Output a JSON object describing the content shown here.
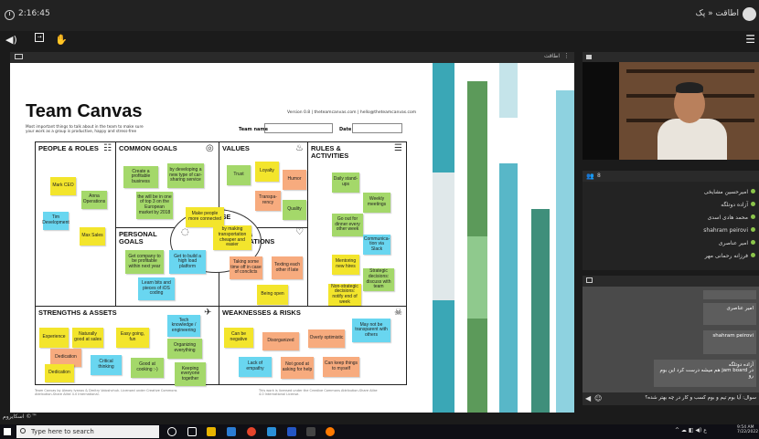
{
  "top_bar": {
    "clock": "2:16:45",
    "room_title": "اطاقت « پک"
  },
  "share_panel": {
    "header_label": "اطاقت",
    "dots": "⋮"
  },
  "canvas": {
    "title": "Team Canvas",
    "subtitle": "Most important things to talk about in the team to make sure your work as a group is productive, happy and stress-free",
    "version": "Version 0.8 | theteamcanvas.com | hello@theteamcanvas.com",
    "team_name_label": "Team name",
    "date_label": "Date",
    "sections": {
      "people": "PEOPLE & ROLES",
      "goals": "COMMON GOALS",
      "values": "VALUES",
      "rules": "RULES & ACTIVITIES",
      "personal": "PERSONAL GOALS",
      "needs": "NEEDS & EXPECTATIONS",
      "strengths": "STRENGTHS & ASSETS",
      "weaknesses": "WEAKNESSES & RISKS",
      "purpose": "PURPOSE"
    },
    "notes": {
      "mark": "Mark\nCEO",
      "anna": "Anna\nOperations",
      "tim": "Tim\nDevelopment",
      "max": "Max\nSales",
      "profitable": "Create a profitable business",
      "carsharing": "by developing a new type of car-sharing service",
      "top3": "the will be in one of top 3 on the European market by 2018",
      "connected": "Make people more connected",
      "transport": "by making transportation cheaper and easier",
      "trust": "Trust",
      "loyalty": "Loyalty",
      "humor": "Humor",
      "transparency": "Transpa-rency",
      "quality": "Quality",
      "standup": "Daily stand-ups",
      "weekly": "Weekly meetings",
      "dinner": "Go out for dinner every other week",
      "slack": "Communica-tion via Slack",
      "mentoring": "Mentoring new hires",
      "strategic": "Strategic decisions: discuss with team",
      "nonstrategic": "Non-strategic decisions: notify end of week",
      "company": "Get company to be profitable within next year",
      "platform": "Get to build a high load platform",
      "ios": "Learn bits and pieces of iOS coding",
      "timeoff": "Taking some time off in case of conclicts",
      "texting": "Texting each other if late",
      "open": "Being open",
      "tech": "Tech knowledge / engineering",
      "experience": "Experience",
      "naturally": "Naturally good at sales",
      "easygoing": "Easy going, fun",
      "organizing": "Organizing everything",
      "dedication1": "Dedication",
      "critical": "Critical thinking",
      "cooking": "Good at cooking :-)",
      "keeping": "Keeping everyone together",
      "dedication2": "Dedication",
      "negative": "Can be negative",
      "disorganized": "Disorganized",
      "optimistic": "Overly optimistic",
      "transparent": "May not be transparent with others",
      "empathy": "Lack of empathy",
      "help": "Not good at asking for help",
      "keepthings": "Can keep things to myself"
    },
    "footer_left": "Team Canvas by Alexey Ivanov & Dmitry Voloshchuk. Licensed under Creative Commons Attribution-Share Alike 4.0 International.",
    "footer_right": "This work is licensed under the Creative Commons Attribution-Share Alike 4.0 International License."
  },
  "users_panel": {
    "count": "8",
    "users": [
      "امیرحسین مشایخی",
      "آزاده دوتلگه",
      "محمد هادی اسدی",
      "shahram peirovi",
      "امیر عناصری",
      "فرزانه رحمانی مهر"
    ]
  },
  "chat_panel": {
    "messages": [
      {
        "name": "امیر عناصری"
      },
      {
        "name": "shahram peirovi"
      },
      {
        "name": "آزاده دوتلگه",
        "text": "در jam board هم میشه درست کرد این بوم رو"
      }
    ],
    "input_value": "سوال: آیا بوم تیم و بوم کسب و کار در چه بهتر شده؟"
  },
  "status_bar": {
    "text": "اسکایروم ©™"
  },
  "taskbar": {
    "search_placeholder": "Type here to search",
    "time": "9:54 AM",
    "date": "7/22/2022"
  }
}
